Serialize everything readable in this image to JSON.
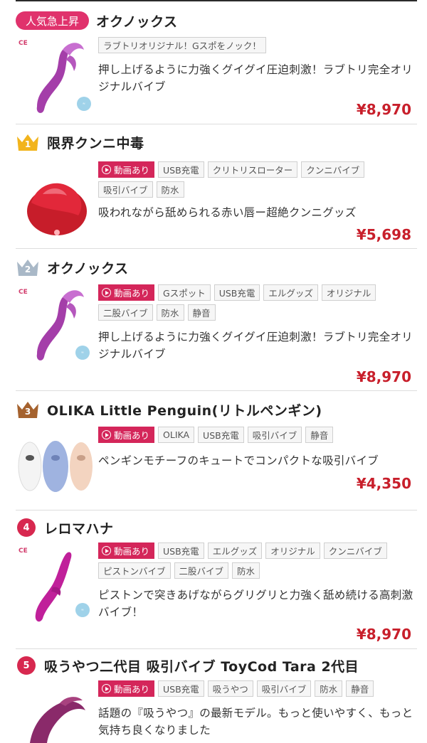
{
  "items": [
    {
      "rank_label": "人気急上昇",
      "title": "オクノックス",
      "tags": [
        "ラブトリオリジナル！Gスポをノック！"
      ],
      "description": "押し上げるように力強くグイグイ圧迫刺激！ラブトリ完全オリジナルバイブ",
      "price": "¥8,970"
    },
    {
      "rank_label": "1",
      "title": "限界クンニ中毒",
      "video_tag": "動画あり",
      "tags": [
        "USB充電",
        "クリトリスローター",
        "クンニバイブ",
        "吸引バイブ",
        "防水"
      ],
      "description": "吸われながら舐められる赤い唇ー超絶クンニグッズ",
      "price": "¥5,698"
    },
    {
      "rank_label": "2",
      "title": "オクノックス",
      "video_tag": "動画あり",
      "tags": [
        "Gスポット",
        "USB充電",
        "エルグッズ",
        "オリジナル",
        "二股バイブ",
        "防水",
        "静音"
      ],
      "description": "押し上げるように力強くグイグイ圧迫刺激！ラブトリ完全オリジナルバイブ",
      "price": "¥8,970"
    },
    {
      "rank_label": "3",
      "title": "OLIKA Little Penguin(リトルペンギン)",
      "video_tag": "動画あり",
      "tags": [
        "OLIKA",
        "USB充電",
        "吸引バイブ",
        "静音"
      ],
      "description": "ペンギンモチーフのキュートでコンパクトな吸引バイブ",
      "price": "¥4,350"
    },
    {
      "rank_label": "4",
      "title": "レロマハナ",
      "video_tag": "動画あり",
      "tags": [
        "USB充電",
        "エルグッズ",
        "オリジナル",
        "クンニバイブ",
        "ピストンバイブ",
        "二股バイブ",
        "防水"
      ],
      "description": "ピストンで突きあげながらグリグリと力強く舐め続ける高刺激バイブ！",
      "price": "¥8,970"
    },
    {
      "rank_label": "5",
      "title": "吸うやつ二代目 吸引バイブ ToyCod Tara 2代目",
      "video_tag": "動画あり",
      "tags": [
        "USB充電",
        "吸うやつ",
        "吸引バイブ",
        "防水",
        "静音"
      ],
      "description": "話題の『吸うやつ』の最新モデル。もっと使いやすく、もっと気持ち良くなりました"
    }
  ],
  "brand_logo_text": "CE",
  "colors": {
    "accent": "#e0326c",
    "price": "#c81f2b",
    "gold": "#f2b41c",
    "silver": "#a9b8c7",
    "bronze": "#a5622e",
    "video_tag": "#d4265a"
  }
}
